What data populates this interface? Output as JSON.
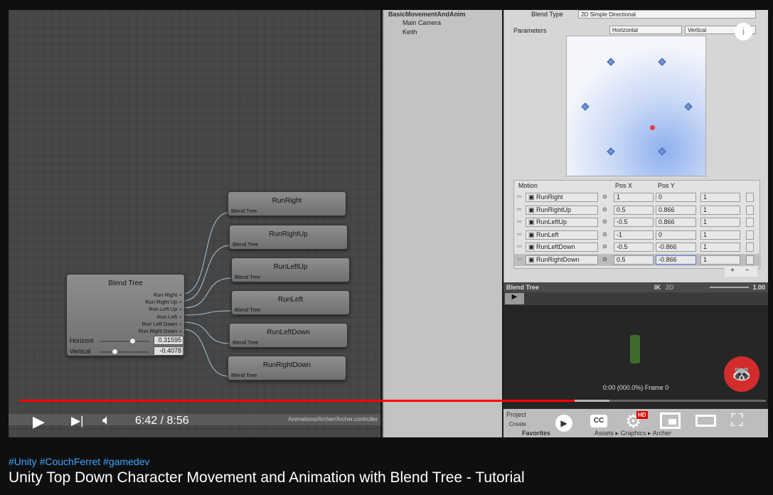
{
  "hierarchy": {
    "root": "BasicMovementAndAnim",
    "items": [
      "Main Camera",
      "Keith"
    ]
  },
  "inspector": {
    "blend_type_label": "Blend Type",
    "blend_type": "2D Simple Directional",
    "parameters_label": "Parameters",
    "param_x": "Horizontal",
    "param_y": "Vertical",
    "points": [
      {
        "x": 1,
        "y": 0
      },
      {
        "x": 0.5,
        "y": 0.866
      },
      {
        "x": -0.5,
        "y": 0.866
      },
      {
        "x": -1,
        "y": 0
      },
      {
        "x": -0.5,
        "y": -0.866
      },
      {
        "x": 0.5,
        "y": -0.866
      }
    ],
    "current": {
      "x": 0.31595,
      "y": -0.4078
    },
    "table": {
      "headers": [
        "Motion",
        "Pos X",
        "Pos Y"
      ],
      "rows": [
        {
          "motion": "RunRight",
          "x": "1",
          "y": "0",
          "speed": "1"
        },
        {
          "motion": "RunRightUp",
          "x": "0.5",
          "y": "0.866",
          "speed": "1"
        },
        {
          "motion": "RunLeftUp",
          "x": "-0.5",
          "y": "0.866",
          "speed": "1"
        },
        {
          "motion": "RunLeft",
          "x": "-1",
          "y": "0",
          "speed": "1"
        },
        {
          "motion": "RunLeftDown",
          "x": "-0.5",
          "y": "-0.866",
          "speed": "1"
        },
        {
          "motion": "RunRightDown",
          "x": "0.5",
          "y": "-0.866",
          "speed": "1"
        }
      ]
    },
    "add": "+",
    "remove": "−"
  },
  "blendbar": {
    "title": "Blend Tree",
    "ik": "IK",
    "twod": "2D",
    "speed": "1.00"
  },
  "preview": {
    "frame": "0:00 (000.0%) Frame 0"
  },
  "graph": {
    "blend_tree": {
      "title": "Blend Tree",
      "outputs": [
        "Run Right",
        "Run Right Up",
        "Run Left Up",
        "Run Left",
        "Run Left Down",
        "Run Right Down"
      ],
      "param1_label": "Horizont",
      "param1_value": "0.31595",
      "param2_label": "Vertical",
      "param2_value": "-0.4078"
    },
    "nodes": [
      {
        "name": "RunRight",
        "sub": "Blend Tree"
      },
      {
        "name": "RunRightUp",
        "sub": "Blend Tree"
      },
      {
        "name": "RunLeftUp",
        "sub": "Blend Tree"
      },
      {
        "name": "RunLeft",
        "sub": "Blend Tree"
      },
      {
        "name": "RunLeftDown",
        "sub": "Blend Tree"
      },
      {
        "name": "RunRightDown",
        "sub": "Blend Tree"
      }
    ],
    "path": "Animations/Archer/Archer.controller"
  },
  "project": {
    "tab": "Project",
    "create": "Create",
    "favorites": "Favorites",
    "breadcrumb": "Assets ▸ Graphics ▸ Archer"
  },
  "player": {
    "time": "6:42 / 8:56",
    "progress": 0.744,
    "buffered": 0.79,
    "hd": "HD",
    "accent": "#ff0000"
  },
  "video": {
    "tags": "#Unity #CouchFerret #gamedev",
    "title": "Unity Top Down Character Movement and Animation with Blend Tree - Tutorial"
  }
}
